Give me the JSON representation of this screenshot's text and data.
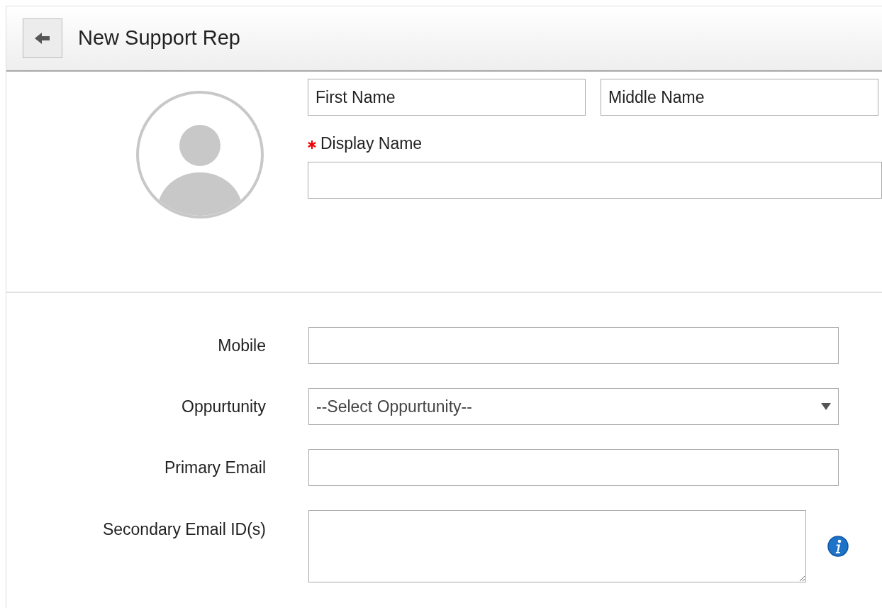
{
  "header": {
    "title": "New Support Rep"
  },
  "name_fields": [
    {
      "placeholder": "First Name"
    },
    {
      "placeholder": "Middle Name"
    }
  ],
  "display_name": {
    "label": "Display Name",
    "required": true
  },
  "fields": [
    {
      "kind": "text",
      "label": "Mobile"
    },
    {
      "kind": "select",
      "label": "Oppurtunity",
      "value": "--Select Oppurtunity--"
    },
    {
      "kind": "text",
      "label": "Primary Email"
    },
    {
      "kind": "textarea",
      "label": "Secondary Email ID(s)",
      "info": true
    }
  ]
}
